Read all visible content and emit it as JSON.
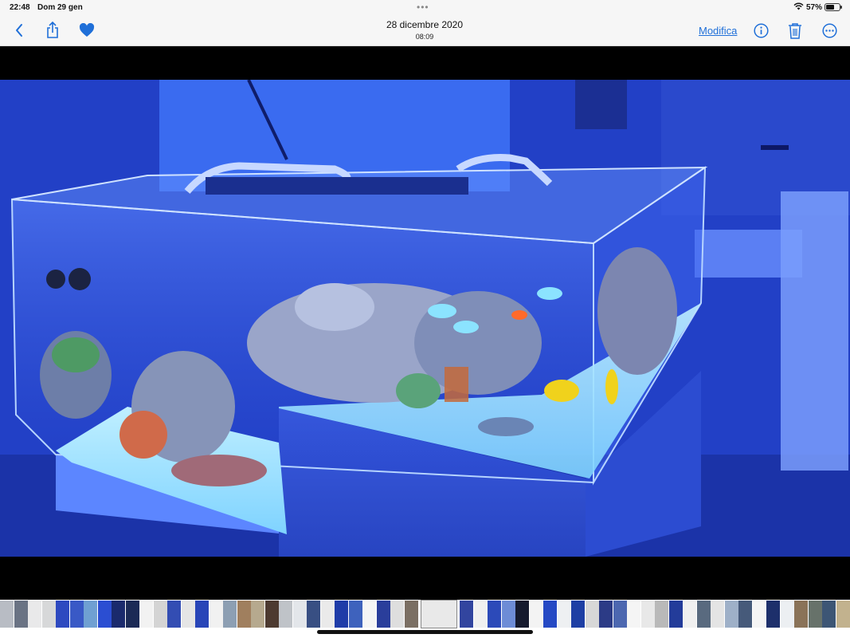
{
  "status": {
    "time": "22:48",
    "date": "Dom 29 gen",
    "battery_text": "57%",
    "battery_level": 0.57
  },
  "nav": {
    "title": "28 dicembre 2020",
    "subtitle": "08:09",
    "edit_label": "Modifica",
    "icons": [
      "chevron-left-icon",
      "share-icon",
      "heart-icon",
      "info-icon",
      "trash-icon",
      "more-icon"
    ],
    "accent": "#1f6fd8"
  },
  "photo": {
    "tank_text_none": ""
  },
  "filmstrip": {
    "thumb_colors": [
      "#b8bcc4",
      "#6a7384",
      "#e9e9ea",
      "#d7d8d9",
      "#2d49c0",
      "#3959c6",
      "#6fa0d2",
      "#2b4ed2",
      "#1a2a6d",
      "#1b2a56",
      "#f2f2f2",
      "#d4d4d4",
      "#334db3",
      "#e5e5e5",
      "#2845b8",
      "#f1f1f1",
      "#8d9fb3",
      "#a07f5e",
      "#b6a98e",
      "#4d3a30",
      "#bfc3c8",
      "#e3e6ea",
      "#384f83",
      "#eaeaea",
      "#1f3ca8",
      "#3e62bd",
      "#f5f5f5",
      "#2a3e9b",
      "#dedede",
      "#7b6f63",
      "#e9e9e9",
      "#32459f",
      "#f0f0f0",
      "#2c4ab9",
      "#6d8cd6",
      "#151a2e",
      "#f3f3f3",
      "#2549c4",
      "#eef0f2",
      "#1e3fa4",
      "#d7d7d7",
      "#2c3b86",
      "#4c67b0",
      "#f5f5f5",
      "#e8e8e8",
      "#b9b9b9",
      "#233c9a",
      "#f0f0f0",
      "#596a7f",
      "#e4e4e4",
      "#9eb0c8",
      "#465a7a",
      "#f4f4f4",
      "#1d2f6b",
      "#eceff2",
      "#8a7358",
      "#67726a",
      "#3d5675",
      "#c2b28e",
      "#a3a5a7",
      "#f6f6f6",
      "#e5e3df",
      "#c6b47d",
      "#5b6f8d",
      "#7c8b64",
      "#e4d9a8",
      "#efeff0",
      "#545c6c",
      "#f3f3f3",
      "#e9e6e2",
      "#9f7a55",
      "#c2966b",
      "#a7815d",
      "#3b4f78",
      "#1e2d55"
    ],
    "selected_index": 30
  }
}
